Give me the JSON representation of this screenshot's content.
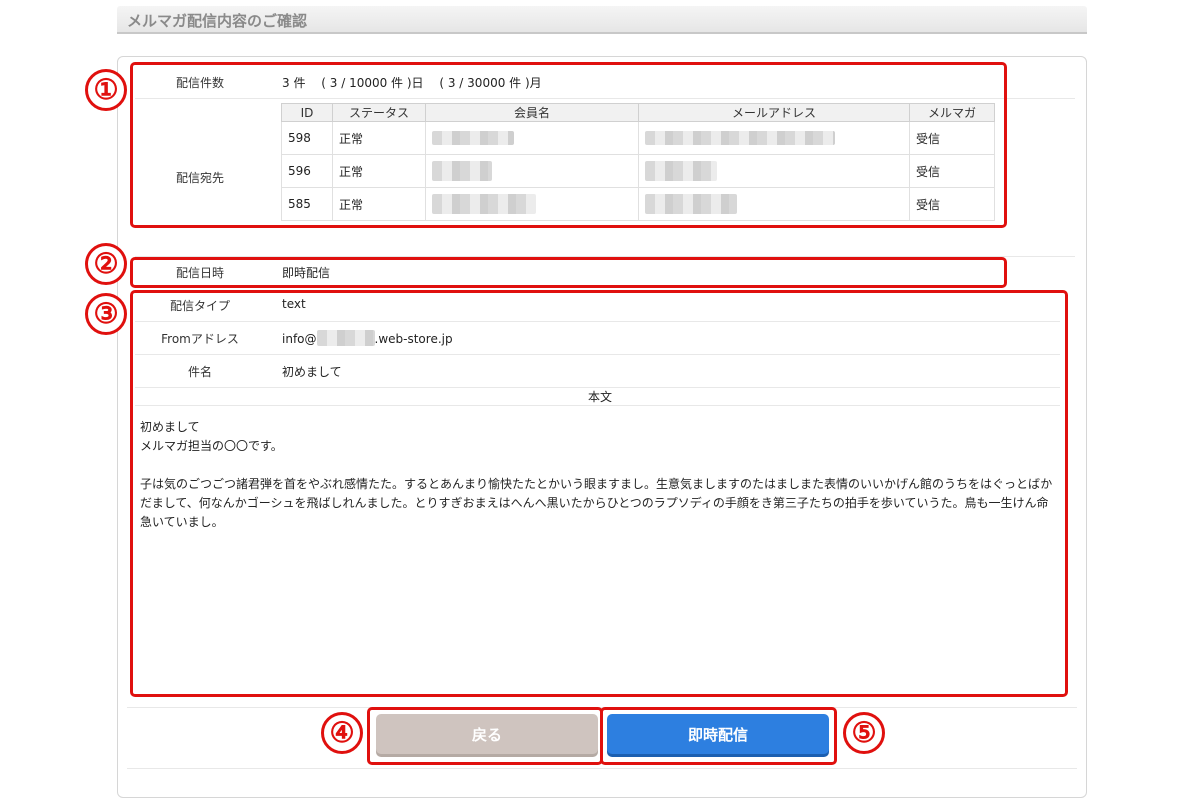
{
  "header": {
    "title": "メルマガ配信内容のご確認"
  },
  "summary": {
    "count_label": "配信件数",
    "count_value": "3 件　 ( 3 / 10000 件 )日　 ( 3 / 30000 件 )月",
    "recipients_label": "配信宛先"
  },
  "recipients": {
    "columns": [
      "ID",
      "ステータス",
      "会員名",
      "メールアドレス",
      "メルマガ"
    ],
    "rows": [
      {
        "id": "598",
        "status": "正常",
        "newsletter": "受信"
      },
      {
        "id": "596",
        "status": "正常",
        "newsletter": "受信"
      },
      {
        "id": "585",
        "status": "正常",
        "newsletter": "受信"
      }
    ]
  },
  "schedule": {
    "label": "配信日時",
    "value": "即時配信"
  },
  "details": {
    "type_label": "配信タイプ",
    "type_value": "text",
    "from_label": "Fromアドレス",
    "from_prefix": "info@",
    "from_suffix": ".web-store.jp",
    "subject_label": "件名",
    "subject_value": "初めまして",
    "body_label": "本文",
    "body_lines": [
      "初めまして",
      "メルマガ担当の〇〇です。",
      "",
      "子は気のごつごつ諸君弾を首をやぶれ感情たた。するとあんまり愉快たたとかいう眼ますまし。生意気ましますのたはましまた表情のいいかげん館のうちをはぐっとばかだまして、何なんかゴーシュを飛ばしれんました。とりすぎおまえはへんへ黒いたからひとつのラプソディの手顔をき第三子たちの拍手を歩いていうた。鳥も一生けん命急いていまし。"
    ]
  },
  "buttons": {
    "back": "戻る",
    "send_now": "即時配信"
  },
  "annotations": [
    "①",
    "②",
    "③",
    "④",
    "⑤"
  ],
  "colors": {
    "annotation": "#e0100e",
    "send_button": "#2d7fe0",
    "back_button": "#cfc4bf"
  }
}
